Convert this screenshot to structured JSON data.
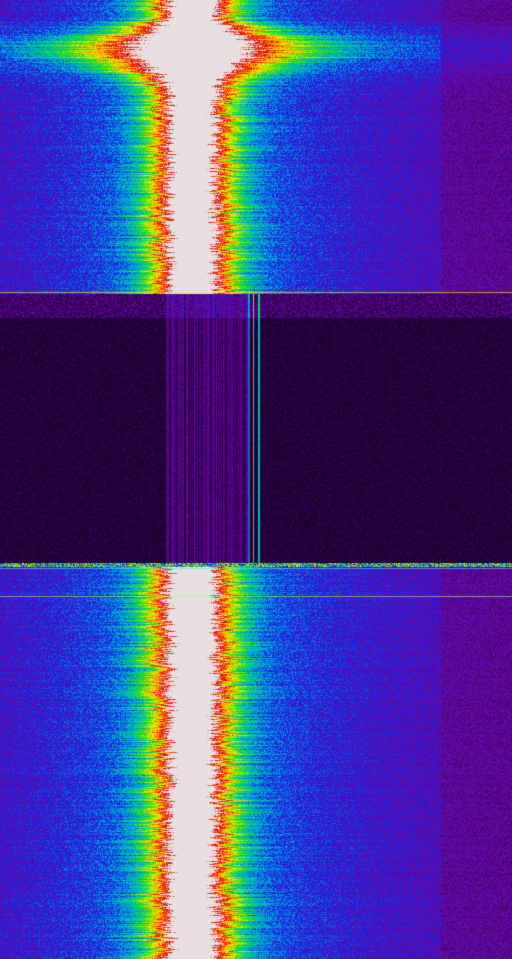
{
  "view": {
    "type": "spectrogram-waterfall",
    "orientation": "vertical",
    "colormap": [
      "#000000",
      "#3a0060",
      "#6a0aa8",
      "#1a20e0",
      "#00a0e0",
      "#00d080",
      "#60e000",
      "#f0f000",
      "#ff8000",
      "#e00000",
      "#e8e0e0"
    ],
    "background_color": "#060008",
    "signal_peak_color": "#e8e8e8",
    "segments": [
      {
        "name": "signal",
        "level": "strong"
      },
      {
        "name": "dropout",
        "level": "none"
      },
      {
        "name": "signal",
        "level": "strong"
      }
    ],
    "narrowband_carrier_visible": true
  }
}
